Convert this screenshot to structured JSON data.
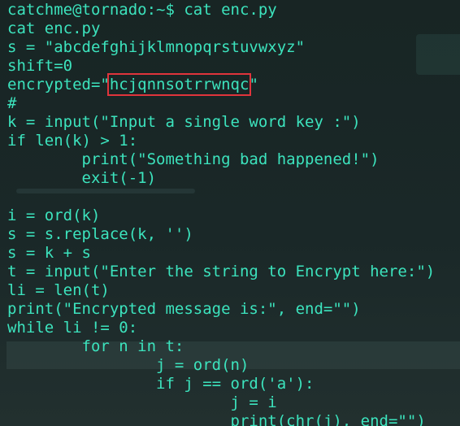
{
  "terminal": {
    "prompt": "catchme@tornado:~$ cat enc.py",
    "lines": [
      "cat enc.py",
      "s = \"abcdefghijklmnopqrstuvwxyz\"",
      "shift=0",
      "#",
      "k = input(\"Input a single word key :\")",
      "if len(k) > 1:",
      "        print(\"Something bad happened!\")",
      "        exit(-1)",
      "",
      "i = ord(k)",
      "s = s.replace(k, '')",
      "s = k + s",
      "t = input(\"Enter the string to Encrypt here:\")",
      "li = len(t)",
      "print(\"Encrypted message is:\", end=\"\")",
      "while li != 0:",
      "        for n in t:",
      "                j = ord(n)",
      "                if j == ord('a'):",
      "                        j = i",
      "                        print(chr(j), end=\"\")"
    ],
    "encrypted_prefix": "encrypted=\"",
    "encrypted_value": "hcjqnnsotrrwnqc",
    "encrypted_suffix": "\"",
    "highlight_color": "#e0343c",
    "text_color": "#3ce3bd"
  }
}
